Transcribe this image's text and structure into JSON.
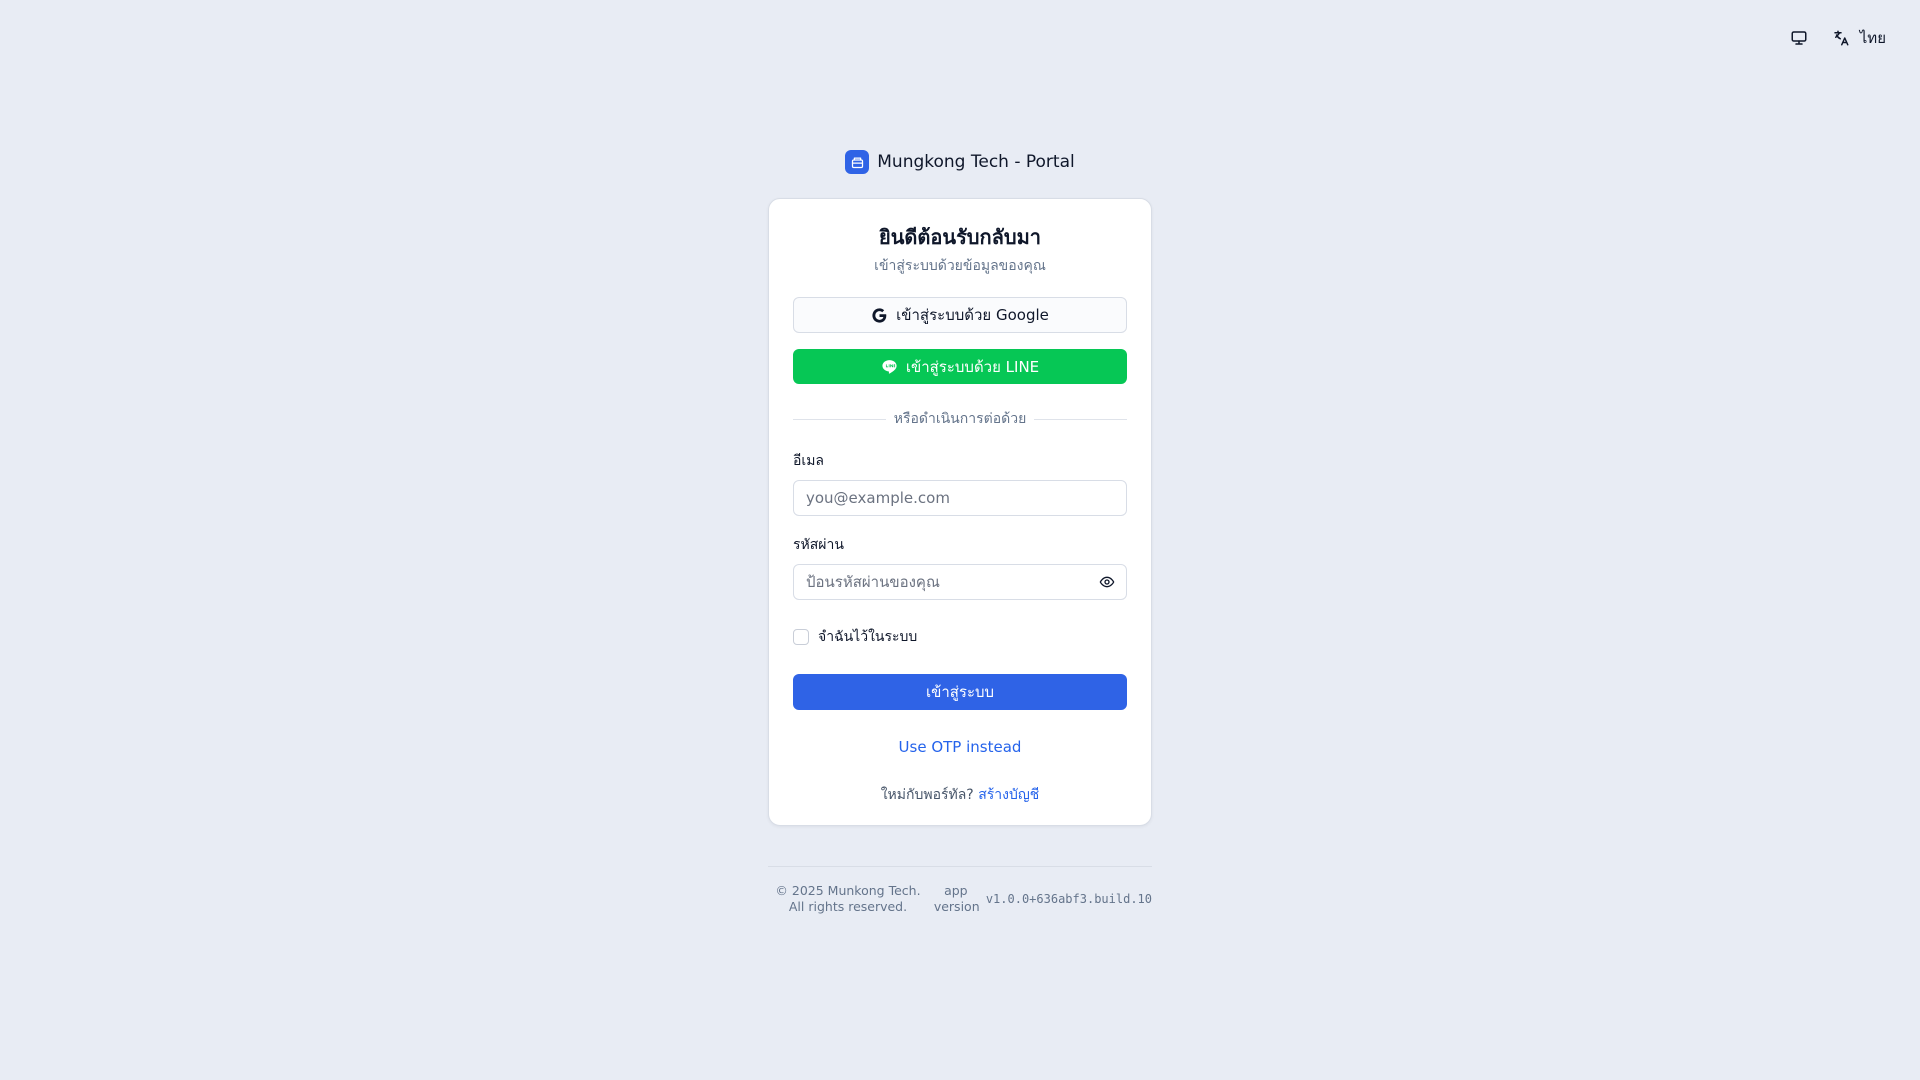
{
  "topbar": {
    "display_icon": "monitor-icon",
    "language_icon": "translate-icon",
    "language_label": "ไทย"
  },
  "brand": {
    "logo_icon": "package-icon",
    "title": "Mungkong Tech - Portal",
    "accent": "#2f63e6"
  },
  "card": {
    "title": "ยินดีต้อนรับกลับมา",
    "subtitle": "เข้าสู่ระบบด้วยข้อมูลของคุณ",
    "google_button": "เข้าสู่ระบบด้วย Google",
    "line_button": "เข้าสู่ระบบด้วย LINE",
    "line_color": "#06c755",
    "divider_text": "หรือดำเนินการต่อด้วย",
    "email_label": "อีเมล",
    "email_placeholder": "you@example.com",
    "email_value": "",
    "password_label": "รหัสผ่าน",
    "password_placeholder": "ป้อนรหัสผ่านของคุณ",
    "password_value": "",
    "remember_label": "จำฉันไว้ในระบบ",
    "submit_button": "เข้าสู่ระบบ",
    "otp_link": "Use OTP instead",
    "signup_prompt": "ใหม่กับพอร์ทัล?",
    "signup_link": "สร้างบัญชี"
  },
  "footer": {
    "copyright": "© 2025 Munkong Tech. All rights reserved.",
    "version_label": "app version",
    "version_value": "v1.0.0+636abf3.build.10"
  }
}
